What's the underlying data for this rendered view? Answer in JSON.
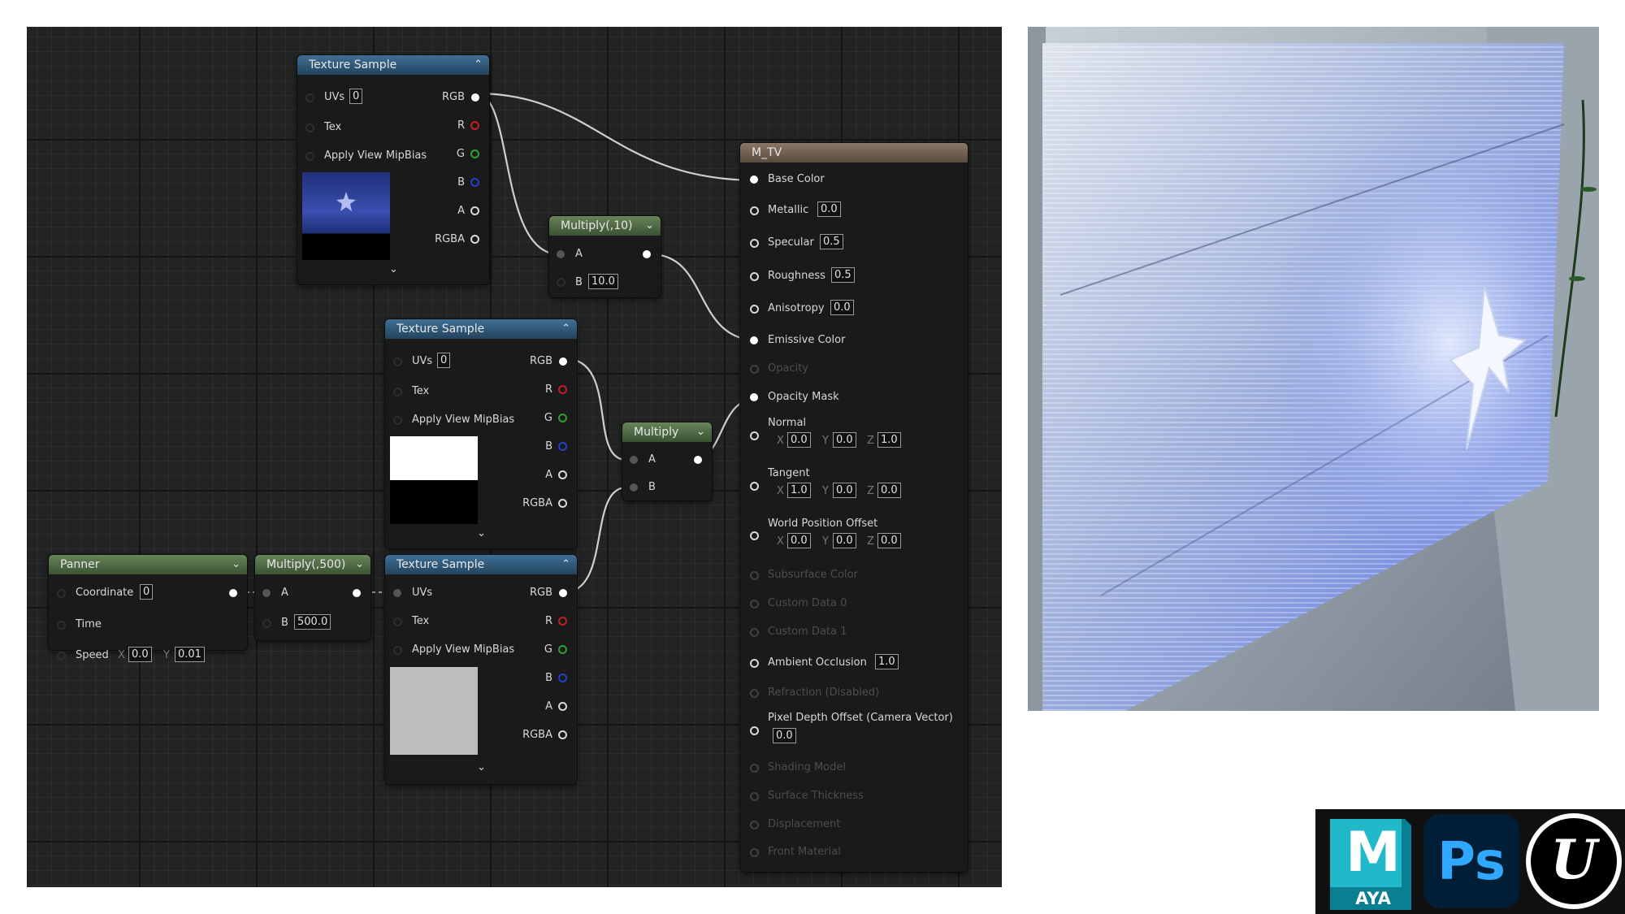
{
  "nodes": {
    "tex1": {
      "title": "Texture Sample",
      "uvs_label": "UVs",
      "uvs_value": "0",
      "tex_label": "Tex",
      "mip_label": "Apply View MipBias",
      "out_rgb": "RGB",
      "out_r": "R",
      "out_g": "G",
      "out_b": "B",
      "out_a": "A",
      "out_rgba": "RGBA"
    },
    "mult10": {
      "title": "Multiply(,10)",
      "a_label": "A",
      "b_label": "B",
      "b_value": "10.0"
    },
    "tex2": {
      "title": "Texture Sample",
      "uvs_label": "UVs",
      "uvs_value": "0",
      "tex_label": "Tex",
      "mip_label": "Apply View MipBias",
      "out_rgb": "RGB",
      "out_r": "R",
      "out_g": "G",
      "out_b": "B",
      "out_a": "A",
      "out_rgba": "RGBA"
    },
    "mult": {
      "title": "Multiply",
      "a_label": "A",
      "b_label": "B"
    },
    "panner": {
      "title": "Panner",
      "coord_label": "Coordinate",
      "coord_value": "0",
      "time_label": "Time",
      "speed_label": "Speed",
      "speed_x_label": "X",
      "speed_x": "0.0",
      "speed_y_label": "Y",
      "speed_y": "0.01"
    },
    "mult500": {
      "title": "Multiply(,500)",
      "a_label": "A",
      "b_label": "B",
      "b_value": "500.0"
    },
    "tex3": {
      "title": "Texture Sample",
      "uvs_label": "UVs",
      "tex_label": "Tex",
      "mip_label": "Apply View MipBias",
      "out_rgb": "RGB",
      "out_r": "R",
      "out_g": "G",
      "out_b": "B",
      "out_a": "A",
      "out_rgba": "RGBA"
    }
  },
  "material": {
    "title": "M_TV",
    "base_color": "Base Color",
    "metallic": {
      "label": "Metallic",
      "value": "0.0"
    },
    "specular": {
      "label": "Specular",
      "value": "0.5"
    },
    "roughness": {
      "label": "Roughness",
      "value": "0.5"
    },
    "anisotropy": {
      "label": "Anisotropy",
      "value": "0.0"
    },
    "emissive": "Emissive Color",
    "opacity": "Opacity",
    "opacity_mask": "Opacity Mask",
    "normal": {
      "label": "Normal",
      "x": "0.0",
      "y": "0.0",
      "z": "1.0"
    },
    "tangent": {
      "label": "Tangent",
      "x": "1.0",
      "y": "0.0",
      "z": "0.0"
    },
    "wpo": {
      "label": "World Position Offset",
      "x": "0.0",
      "y": "0.0",
      "z": "0.0"
    },
    "xyz": {
      "x": "X",
      "y": "Y",
      "z": "Z"
    },
    "subsurface": "Subsurface Color",
    "custom0": "Custom Data 0",
    "custom1": "Custom Data 1",
    "ao": {
      "label": "Ambient Occlusion",
      "value": "1.0"
    },
    "refraction": "Refraction (Disabled)",
    "pdo": {
      "label": "Pixel Depth Offset (Camera Vector)",
      "value": "0.0"
    },
    "shading_model": "Shading Model",
    "surface_thickness": "Surface Thickness",
    "displacement": "Displacement",
    "front_material": "Front Material"
  },
  "logos": {
    "maya_letter": "M",
    "maya_text": "AYA",
    "ps_text": "Ps",
    "unreal_letter": "U"
  },
  "colors": {
    "node_header_blue": "#2f5676",
    "node_header_green": "#4c6a42",
    "material_header": "#7a685a",
    "graph_bg": "#222323",
    "photoshop_blue": "#31a8ff",
    "maya_teal": "#0fa3b8"
  }
}
